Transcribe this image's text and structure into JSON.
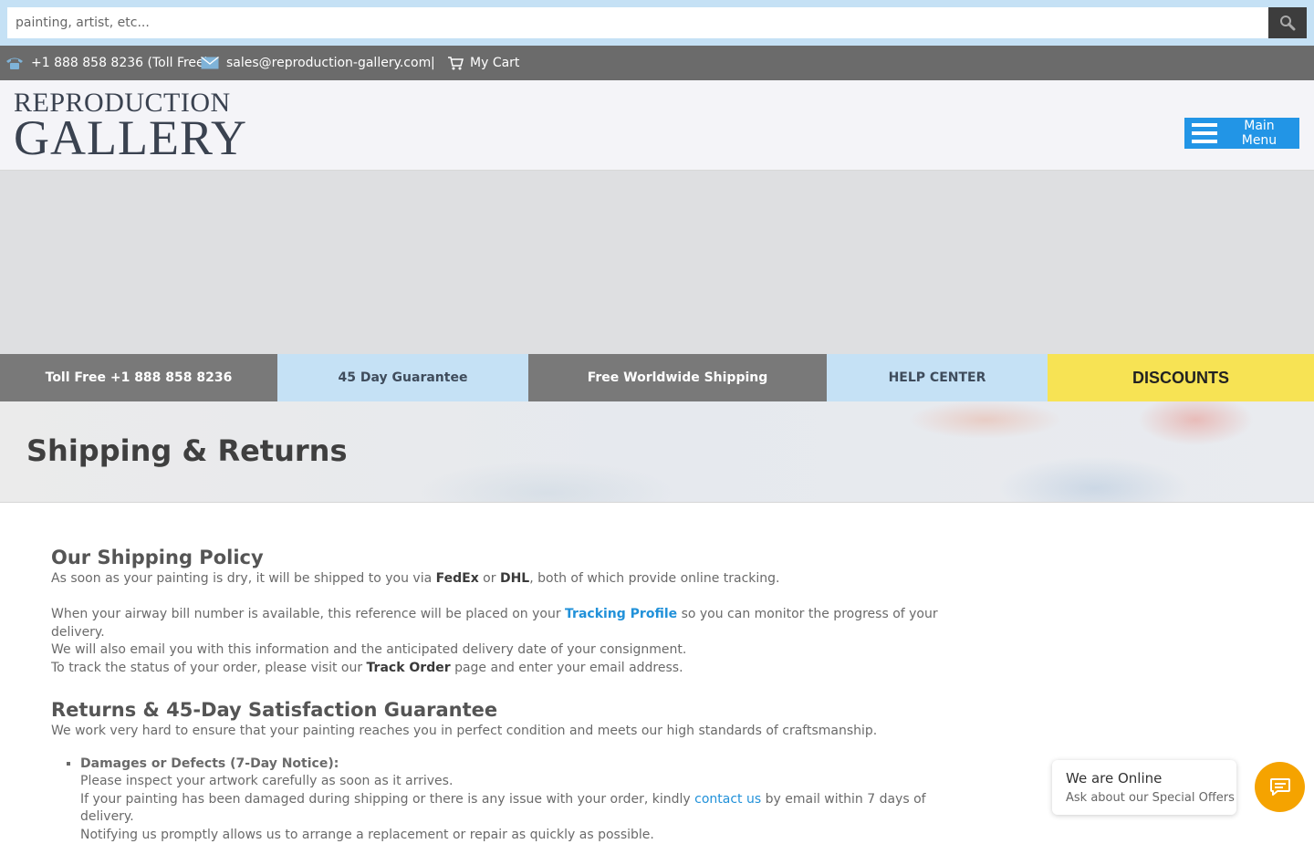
{
  "search": {
    "placeholder": "painting, artist, etc..."
  },
  "contact": {
    "phone": "+1 888 858 8236 (Toll Free)",
    "email": "sales@reproduction-gallery.com",
    "separator": "|",
    "cart": "My Cart"
  },
  "logo": {
    "line1": "REPRODUCTION",
    "line2": "GALLERY"
  },
  "menu": {
    "label": "Main Menu"
  },
  "strip": [
    {
      "label": "Toll Free +1 888 858 8236",
      "bg": "#797979",
      "fg": "#ffffff"
    },
    {
      "label": "45 Day Guarantee",
      "bg": "#c5e1f5",
      "fg": "#3f4c5c"
    },
    {
      "label": "Free Worldwide Shipping",
      "bg": "#797979",
      "fg": "#ffffff"
    },
    {
      "label": "HELP CENTER",
      "bg": "#c5e1f5",
      "fg": "#3f4c5c"
    },
    {
      "label": "DISCOUNTS",
      "bg": "#f7e354",
      "fg": "#222222"
    }
  ],
  "page": {
    "title": "Shipping & Returns"
  },
  "shipping": {
    "heading": "Our Shipping Policy",
    "p1_a": "As soon as your painting is dry, it will be shipped to you via ",
    "p1_b": "FedEx",
    "p1_c": " or ",
    "p1_d": "DHL",
    "p1_e": ", both of which provide online tracking.",
    "p2_a": "When your airway bill number is available, this reference will be placed on your ",
    "p2_link": "Tracking Profile",
    "p2_b": " so you can monitor the progress of your delivery.",
    "p3": "We will also email you with this information and the anticipated delivery date of your consignment.",
    "p4_a": "To track the status of your order, please visit our ",
    "p4_b": "Track Order",
    "p4_c": " page and enter your email address."
  },
  "returns": {
    "heading": "Returns & 45-Day Satisfaction Guarantee",
    "intro": "We work very hard to ensure that your painting reaches you in perfect condition and meets our high standards of craftsmanship.",
    "item1_title": "Damages or Defects (7-Day Notice):",
    "item1_l1": "Please inspect your artwork carefully as soon as it arrives.",
    "item1_l2a": "If your painting has been damaged during shipping or there is any issue with your order, kindly ",
    "item1_link": "contact us",
    "item1_l2b": " by email within 7 days of delivery.",
    "item1_l3": "Notifying us promptly allows us to arrange a replacement or repair as quickly as possible."
  },
  "chat": {
    "title": "We are Online",
    "subtitle": "Ask about our Special Offers"
  },
  "colors": {
    "accent": "#2295e6",
    "link": "#2191d9",
    "chat": "#f5a300"
  }
}
